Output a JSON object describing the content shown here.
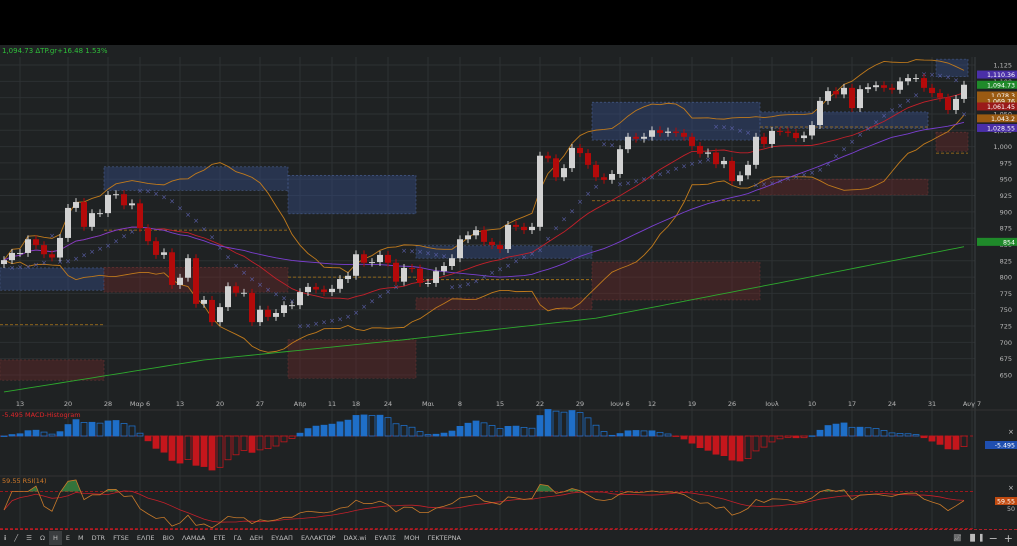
{
  "header": {
    "quote_text": "1,094.73 ΔTP.gr+16.48 1.53%"
  },
  "colors": {
    "bg": "#1f2223",
    "grid": "#2d3133",
    "up": "#d2d2d2",
    "down": "#b30a0a",
    "bollinger": "#c07a1c",
    "sma_red": "#c4202a",
    "sma_purple": "#7a3fd0",
    "sma_green": "#2eaa2e",
    "psar": "#5a5fa8",
    "macd_up": "#1f6fc8",
    "macd_down": "#c4161c",
    "rsi": "#c87a2a"
  },
  "chart_data": {
    "type": "candlestick",
    "symbol": "ΔTP.gr",
    "ylim": [
      630,
      1140
    ],
    "y_ticks": [
      "650",
      "675",
      "700",
      "725",
      "750",
      "775",
      "800",
      "825",
      "850",
      "875",
      "900",
      "925",
      "950",
      "975",
      "1,000",
      "1,025",
      "1,050",
      "1,075",
      "1,100",
      "1,125"
    ],
    "x_labels": [
      {
        "i": 2,
        "t": "13"
      },
      {
        "i": 8,
        "t": "20"
      },
      {
        "i": 13,
        "t": "28"
      },
      {
        "i": 17,
        "t": "Μαρ 6"
      },
      {
        "i": 22,
        "t": "13"
      },
      {
        "i": 27,
        "t": "20"
      },
      {
        "i": 32,
        "t": "27"
      },
      {
        "i": 37,
        "t": "Απρ"
      },
      {
        "i": 41,
        "t": "11"
      },
      {
        "i": 44,
        "t": "18"
      },
      {
        "i": 48,
        "t": "24"
      },
      {
        "i": 53,
        "t": "Μαι"
      },
      {
        "i": 57,
        "t": "8"
      },
      {
        "i": 62,
        "t": "15"
      },
      {
        "i": 67,
        "t": "22"
      },
      {
        "i": 72,
        "t": "29"
      },
      {
        "i": 77,
        "t": "Ιουν 6"
      },
      {
        "i": 81,
        "t": "12"
      },
      {
        "i": 86,
        "t": "19"
      },
      {
        "i": 91,
        "t": "26"
      },
      {
        "i": 96,
        "t": "Ιουλ"
      },
      {
        "i": 101,
        "t": "10"
      },
      {
        "i": 106,
        "t": "17"
      },
      {
        "i": 111,
        "t": "24"
      },
      {
        "i": 116,
        "t": "31"
      },
      {
        "i": 121,
        "t": "Αυγ 7"
      }
    ],
    "closes": [
      826,
      837,
      837,
      858,
      849,
      835,
      830,
      860,
      906,
      915,
      877,
      898,
      898,
      926,
      927,
      910,
      913,
      875,
      855,
      834,
      838,
      788,
      799,
      829,
      759,
      765,
      731,
      754,
      786,
      776,
      776,
      731,
      750,
      739,
      745,
      757,
      757,
      777,
      785,
      781,
      777,
      782,
      797,
      802,
      835,
      822,
      823,
      834,
      822,
      793,
      814,
      813,
      791,
      791,
      809,
      817,
      829,
      858,
      864,
      872,
      854,
      849,
      843,
      880,
      877,
      872,
      877,
      986,
      982,
      953,
      967,
      998,
      990,
      972,
      953,
      949,
      958,
      996,
      1015,
      1012,
      1015,
      1025,
      1021,
      1023,
      1021,
      1015,
      1001,
      989,
      991,
      973,
      978,
      947,
      956,
      972,
      1015,
      1004,
      1024,
      1023,
      1021,
      1013,
      1017,
      1033,
      1070,
      1085,
      1080,
      1090,
      1059,
      1088,
      1091,
      1094,
      1090,
      1087,
      1100,
      1105,
      1105,
      1090,
      1082,
      1075,
      1056,
      1073,
      1094.73
    ],
    "sma200_points": [
      [
        0,
        624
      ],
      [
        25,
        673
      ],
      [
        50,
        704
      ],
      [
        74,
        737
      ],
      [
        99,
        796
      ],
      [
        121,
        849
      ]
    ],
    "zones": [
      {
        "kind": "supply",
        "from": 13,
        "to": 36,
        "top": 969,
        "bottom": 933
      },
      {
        "kind": "supply",
        "from": 36,
        "to": 52,
        "top": 956,
        "bottom": 897
      },
      {
        "kind": "supply",
        "from": 0,
        "to": 13,
        "top": 814,
        "bottom": 780
      },
      {
        "kind": "supply",
        "from": 52,
        "to": 74,
        "top": 848,
        "bottom": 829
      },
      {
        "kind": "supply",
        "from": 74,
        "to": 95,
        "top": 1068,
        "bottom": 1010
      },
      {
        "kind": "supply",
        "from": 95,
        "to": 116,
        "top": 1053,
        "bottom": 1028
      },
      {
        "kind": "supply",
        "from": 117,
        "to": 121,
        "top": 1134,
        "bottom": 1107
      },
      {
        "kind": "demand",
        "from": 0,
        "to": 13,
        "top": 673,
        "bottom": 642
      },
      {
        "kind": "demand",
        "from": 13,
        "to": 36,
        "top": 815,
        "bottom": 777
      },
      {
        "kind": "demand",
        "from": 36,
        "to": 52,
        "top": 704,
        "bottom": 645
      },
      {
        "kind": "demand",
        "from": 52,
        "to": 74,
        "top": 768,
        "bottom": 750
      },
      {
        "kind": "demand",
        "from": 74,
        "to": 95,
        "top": 823,
        "bottom": 765
      },
      {
        "kind": "demand",
        "from": 95,
        "to": 116,
        "top": 950,
        "bottom": 926
      },
      {
        "kind": "demand",
        "from": 117,
        "to": 121,
        "top": 1022,
        "bottom": 993
      }
    ],
    "levels": [
      {
        "from": 13,
        "to": 36,
        "price": 872
      },
      {
        "from": 0,
        "to": 13,
        "price": 727
      },
      {
        "from": 36,
        "to": 52,
        "price": 800
      },
      {
        "from": 52,
        "to": 74,
        "price": 796
      },
      {
        "from": 74,
        "to": 95,
        "price": 917
      },
      {
        "from": 95,
        "to": 116,
        "price": 1030
      },
      {
        "from": 117,
        "to": 121,
        "price": 990
      }
    ],
    "price_labels": [
      {
        "text": "1,110.36",
        "price": 1110.36,
        "color": "#4a2fa8"
      },
      {
        "text": "1,094.73",
        "price": 1094.73,
        "color": "#1f8a2a"
      },
      {
        "text": "1,078.3",
        "price": 1078.3,
        "color": "#9a5a12"
      },
      {
        "text": "1,069.76",
        "price": 1069.76,
        "color": "#9a5a12"
      },
      {
        "text": "1,061.45",
        "price": 1061.45,
        "color": "#9a1a1a"
      },
      {
        "text": "1,043.2",
        "price": 1043.2,
        "color": "#9a5a12"
      },
      {
        "text": "1,028.55",
        "price": 1028.55,
        "color": "#4a2fa8"
      },
      {
        "text": "854",
        "price": 854,
        "color": "#1f8a2a"
      }
    ]
  },
  "macd": {
    "label": "-5.495 MACD-Histogram",
    "value_label": "-5.495"
  },
  "rsi": {
    "label": "59.55 RSI(14)",
    "value_label": "59.55",
    "mid_label": "50"
  },
  "toolbar": {
    "items": [
      "Ω",
      "Η",
      "Ε",
      "Μ",
      "DTR",
      "FTSE",
      "ΕΛΠΕ",
      "ΒΙΟ",
      "ΛΑΜΔΑ",
      "ΕΤΕ",
      "ΓΔ",
      "ΔΕΗ",
      "ΕΥΔΑΠ",
      "ΕΛΛΑΚΤΩΡ",
      "DAX.wi",
      "ΕΥΑΠΣ",
      "ΜΟΗ",
      "ΓΕΚΤΕΡΝΑ"
    ],
    "active": "Η",
    "close_symbol": "×"
  }
}
